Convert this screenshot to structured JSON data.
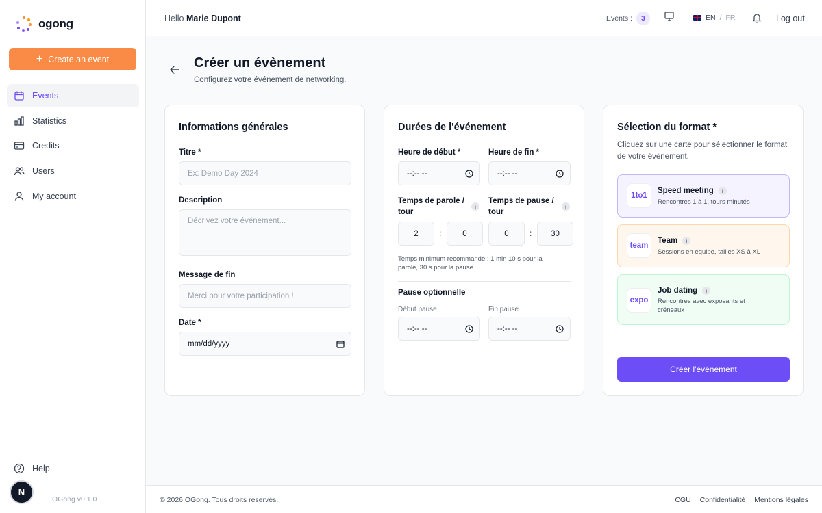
{
  "app": {
    "name": "ogong",
    "version": "OGong v0.1.0"
  },
  "sidebar": {
    "create_label": "Create an event",
    "items": [
      {
        "label": "Events",
        "icon": "calendar-icon",
        "active": true
      },
      {
        "label": "Statistics",
        "icon": "bar-chart-icon"
      },
      {
        "label": "Credits",
        "icon": "credit-card-icon"
      },
      {
        "label": "Users",
        "icon": "users-icon"
      },
      {
        "label": "My account",
        "icon": "user-icon"
      }
    ],
    "help_label": "Help",
    "avatar_letter": "N"
  },
  "header": {
    "hello": "Hello",
    "user_name": "Marie Dupont",
    "events_label": "Events :",
    "events_count": "3",
    "lang_en": "EN",
    "lang_sep": "/",
    "lang_fr": "FR",
    "logout": "Log out"
  },
  "page": {
    "title": "Créer un évènement",
    "subtitle": "Configurez votre événement de networking."
  },
  "general": {
    "title": "Informations générales",
    "titre_label": "Titre *",
    "titre_placeholder": "Ex: Demo Day 2024",
    "description_label": "Description",
    "description_placeholder": "Décrivez votre événement...",
    "message_label": "Message de fin",
    "message_placeholder": "Merci pour votre participation !",
    "date_label": "Date *",
    "date_value": "mm/dd/yyyy"
  },
  "durations": {
    "title": "Durées de l'événement",
    "start_label": "Heure de début *",
    "end_label": "Heure de fin *",
    "time_placeholder": "--:-- --",
    "talk_label_1": "Temps de parole /",
    "talk_label_2": "tour",
    "pause_label_1": "Temps de pause /",
    "pause_label_2": "tour",
    "talk_min": "2",
    "talk_sec": "0",
    "pause_min": "0",
    "pause_sec": "30",
    "colon": ":",
    "hint_1": "Temps minimum recommandé : 1 min 10 s pour la",
    "hint_2": "parole, 30 s pour la pause.",
    "optional_title": "Pause optionnelle",
    "pause_start_label": "Début pause",
    "pause_end_label": "Fin pause"
  },
  "format": {
    "title": "Sélection du format *",
    "desc": "Cliquez sur une carte pour sélectionner le format de votre événement.",
    "options": [
      {
        "code": "1to1",
        "name": "Speed meeting",
        "desc": "Rencontres 1 à 1, tours minutés",
        "selected": true
      },
      {
        "code": "team",
        "name": "Team",
        "desc": "Sessions en équipe, tailles XS à XL"
      },
      {
        "code": "expo",
        "name": "Job dating",
        "desc": "Rencontres avec exposants et créneaux"
      }
    ],
    "info_glyph": "i",
    "submit": "Créer l'événement"
  },
  "footer": {
    "copyright": "© 2026 OGong. Tous droits reservés.",
    "links": [
      "CGU",
      "Confidentialité",
      "Mentions légales"
    ]
  },
  "colors": {
    "accent": "#6d4ef6",
    "brand_orange": "#f98b46",
    "speed_bg": "#f5f3ff",
    "speed_border": "#c4b5fd",
    "team_bg": "#fff7ed",
    "team_border": "#fed7aa",
    "expo_bg": "#f0fdf4",
    "expo_border": "#bbf7d0"
  }
}
